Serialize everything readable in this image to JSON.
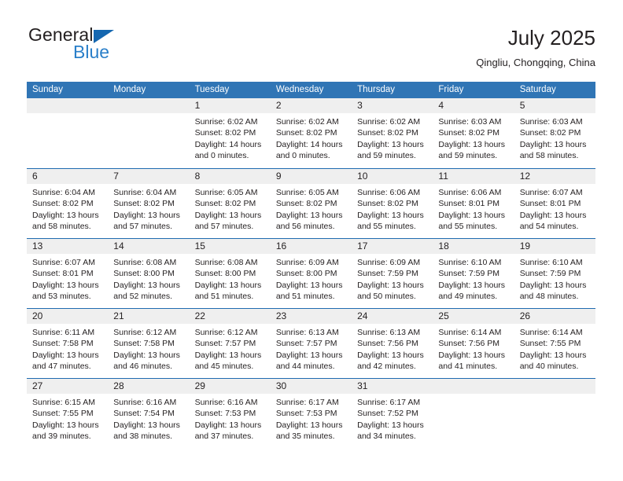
{
  "brand": {
    "name_part1": "General",
    "name_part2": "Blue",
    "colors": {
      "dark": "#231f20",
      "blue": "#2a7fc9",
      "triangle": "#1567b0"
    }
  },
  "header": {
    "month_title": "July 2025",
    "location": "Qingliu, Chongqing, China"
  },
  "calendar": {
    "accent_header_color": "#3075b5",
    "row_divider_color": "#1f6bb0",
    "daynum_band_color": "#efefef",
    "weekday_headers": [
      "Sunday",
      "Monday",
      "Tuesday",
      "Wednesday",
      "Thursday",
      "Friday",
      "Saturday"
    ],
    "weeks": [
      [
        {
          "day": ""
        },
        {
          "day": ""
        },
        {
          "day": "1",
          "sunrise": "Sunrise: 6:02 AM",
          "sunset": "Sunset: 8:02 PM",
          "daylight_line1": "Daylight: 14 hours",
          "daylight_line2": "and 0 minutes."
        },
        {
          "day": "2",
          "sunrise": "Sunrise: 6:02 AM",
          "sunset": "Sunset: 8:02 PM",
          "daylight_line1": "Daylight: 14 hours",
          "daylight_line2": "and 0 minutes."
        },
        {
          "day": "3",
          "sunrise": "Sunrise: 6:02 AM",
          "sunset": "Sunset: 8:02 PM",
          "daylight_line1": "Daylight: 13 hours",
          "daylight_line2": "and 59 minutes."
        },
        {
          "day": "4",
          "sunrise": "Sunrise: 6:03 AM",
          "sunset": "Sunset: 8:02 PM",
          "daylight_line1": "Daylight: 13 hours",
          "daylight_line2": "and 59 minutes."
        },
        {
          "day": "5",
          "sunrise": "Sunrise: 6:03 AM",
          "sunset": "Sunset: 8:02 PM",
          "daylight_line1": "Daylight: 13 hours",
          "daylight_line2": "and 58 minutes."
        }
      ],
      [
        {
          "day": "6",
          "sunrise": "Sunrise: 6:04 AM",
          "sunset": "Sunset: 8:02 PM",
          "daylight_line1": "Daylight: 13 hours",
          "daylight_line2": "and 58 minutes."
        },
        {
          "day": "7",
          "sunrise": "Sunrise: 6:04 AM",
          "sunset": "Sunset: 8:02 PM",
          "daylight_line1": "Daylight: 13 hours",
          "daylight_line2": "and 57 minutes."
        },
        {
          "day": "8",
          "sunrise": "Sunrise: 6:05 AM",
          "sunset": "Sunset: 8:02 PM",
          "daylight_line1": "Daylight: 13 hours",
          "daylight_line2": "and 57 minutes."
        },
        {
          "day": "9",
          "sunrise": "Sunrise: 6:05 AM",
          "sunset": "Sunset: 8:02 PM",
          "daylight_line1": "Daylight: 13 hours",
          "daylight_line2": "and 56 minutes."
        },
        {
          "day": "10",
          "sunrise": "Sunrise: 6:06 AM",
          "sunset": "Sunset: 8:02 PM",
          "daylight_line1": "Daylight: 13 hours",
          "daylight_line2": "and 55 minutes."
        },
        {
          "day": "11",
          "sunrise": "Sunrise: 6:06 AM",
          "sunset": "Sunset: 8:01 PM",
          "daylight_line1": "Daylight: 13 hours",
          "daylight_line2": "and 55 minutes."
        },
        {
          "day": "12",
          "sunrise": "Sunrise: 6:07 AM",
          "sunset": "Sunset: 8:01 PM",
          "daylight_line1": "Daylight: 13 hours",
          "daylight_line2": "and 54 minutes."
        }
      ],
      [
        {
          "day": "13",
          "sunrise": "Sunrise: 6:07 AM",
          "sunset": "Sunset: 8:01 PM",
          "daylight_line1": "Daylight: 13 hours",
          "daylight_line2": "and 53 minutes."
        },
        {
          "day": "14",
          "sunrise": "Sunrise: 6:08 AM",
          "sunset": "Sunset: 8:00 PM",
          "daylight_line1": "Daylight: 13 hours",
          "daylight_line2": "and 52 minutes."
        },
        {
          "day": "15",
          "sunrise": "Sunrise: 6:08 AM",
          "sunset": "Sunset: 8:00 PM",
          "daylight_line1": "Daylight: 13 hours",
          "daylight_line2": "and 51 minutes."
        },
        {
          "day": "16",
          "sunrise": "Sunrise: 6:09 AM",
          "sunset": "Sunset: 8:00 PM",
          "daylight_line1": "Daylight: 13 hours",
          "daylight_line2": "and 51 minutes."
        },
        {
          "day": "17",
          "sunrise": "Sunrise: 6:09 AM",
          "sunset": "Sunset: 7:59 PM",
          "daylight_line1": "Daylight: 13 hours",
          "daylight_line2": "and 50 minutes."
        },
        {
          "day": "18",
          "sunrise": "Sunrise: 6:10 AM",
          "sunset": "Sunset: 7:59 PM",
          "daylight_line1": "Daylight: 13 hours",
          "daylight_line2": "and 49 minutes."
        },
        {
          "day": "19",
          "sunrise": "Sunrise: 6:10 AM",
          "sunset": "Sunset: 7:59 PM",
          "daylight_line1": "Daylight: 13 hours",
          "daylight_line2": "and 48 minutes."
        }
      ],
      [
        {
          "day": "20",
          "sunrise": "Sunrise: 6:11 AM",
          "sunset": "Sunset: 7:58 PM",
          "daylight_line1": "Daylight: 13 hours",
          "daylight_line2": "and 47 minutes."
        },
        {
          "day": "21",
          "sunrise": "Sunrise: 6:12 AM",
          "sunset": "Sunset: 7:58 PM",
          "daylight_line1": "Daylight: 13 hours",
          "daylight_line2": "and 46 minutes."
        },
        {
          "day": "22",
          "sunrise": "Sunrise: 6:12 AM",
          "sunset": "Sunset: 7:57 PM",
          "daylight_line1": "Daylight: 13 hours",
          "daylight_line2": "and 45 minutes."
        },
        {
          "day": "23",
          "sunrise": "Sunrise: 6:13 AM",
          "sunset": "Sunset: 7:57 PM",
          "daylight_line1": "Daylight: 13 hours",
          "daylight_line2": "and 44 minutes."
        },
        {
          "day": "24",
          "sunrise": "Sunrise: 6:13 AM",
          "sunset": "Sunset: 7:56 PM",
          "daylight_line1": "Daylight: 13 hours",
          "daylight_line2": "and 42 minutes."
        },
        {
          "day": "25",
          "sunrise": "Sunrise: 6:14 AM",
          "sunset": "Sunset: 7:56 PM",
          "daylight_line1": "Daylight: 13 hours",
          "daylight_line2": "and 41 minutes."
        },
        {
          "day": "26",
          "sunrise": "Sunrise: 6:14 AM",
          "sunset": "Sunset: 7:55 PM",
          "daylight_line1": "Daylight: 13 hours",
          "daylight_line2": "and 40 minutes."
        }
      ],
      [
        {
          "day": "27",
          "sunrise": "Sunrise: 6:15 AM",
          "sunset": "Sunset: 7:55 PM",
          "daylight_line1": "Daylight: 13 hours",
          "daylight_line2": "and 39 minutes."
        },
        {
          "day": "28",
          "sunrise": "Sunrise: 6:16 AM",
          "sunset": "Sunset: 7:54 PM",
          "daylight_line1": "Daylight: 13 hours",
          "daylight_line2": "and 38 minutes."
        },
        {
          "day": "29",
          "sunrise": "Sunrise: 6:16 AM",
          "sunset": "Sunset: 7:53 PM",
          "daylight_line1": "Daylight: 13 hours",
          "daylight_line2": "and 37 minutes."
        },
        {
          "day": "30",
          "sunrise": "Sunrise: 6:17 AM",
          "sunset": "Sunset: 7:53 PM",
          "daylight_line1": "Daylight: 13 hours",
          "daylight_line2": "and 35 minutes."
        },
        {
          "day": "31",
          "sunrise": "Sunrise: 6:17 AM",
          "sunset": "Sunset: 7:52 PM",
          "daylight_line1": "Daylight: 13 hours",
          "daylight_line2": "and 34 minutes."
        },
        {
          "day": ""
        },
        {
          "day": ""
        }
      ]
    ]
  }
}
